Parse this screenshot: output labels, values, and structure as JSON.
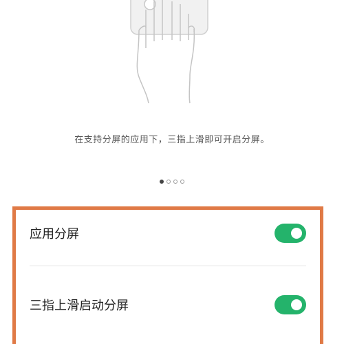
{
  "gesture_illustration": {
    "icon": "three-finger-swipe-hand-icon"
  },
  "caption": "在支持分屏的应用下，三指上滑即可开启分屏。",
  "pager": {
    "count": 4,
    "active_index": 0
  },
  "settings": {
    "items": [
      {
        "label": "应用分屏",
        "enabled": true
      },
      {
        "label": "三指上滑启动分屏",
        "enabled": true
      }
    ]
  },
  "colors": {
    "toggle_on": "#24b36b",
    "highlight_border": "#e07a46"
  }
}
